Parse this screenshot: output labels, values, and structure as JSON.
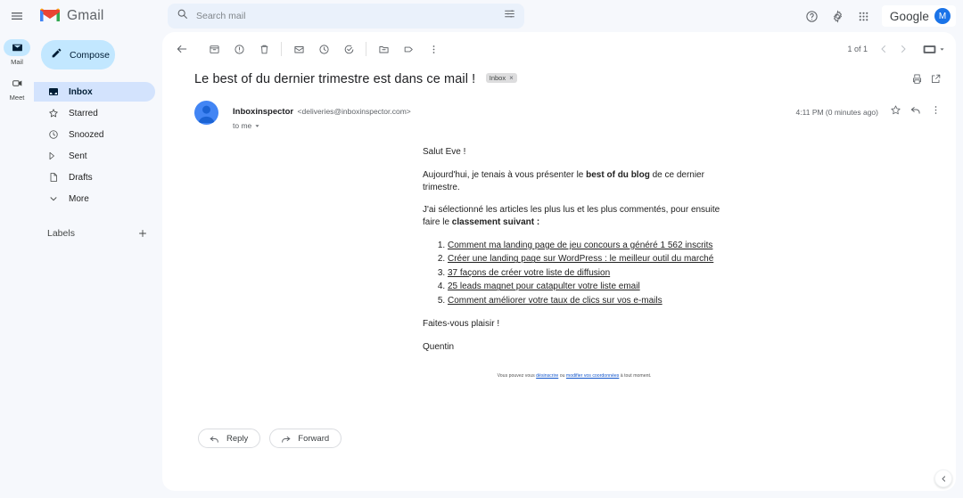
{
  "app": {
    "name": "Gmail"
  },
  "topbar": {
    "menu_icon": "hamburger-icon",
    "logo_icon": "gmail-logo-icon",
    "brand": "Gmail",
    "search": {
      "placeholder": "Search mail",
      "value": ""
    },
    "filter_icon": "search-options-icon",
    "help_icon": "help-icon",
    "settings_icon": "gear-icon",
    "apps_icon": "apps-grid-icon",
    "account": {
      "label": "Google",
      "initial": "M"
    }
  },
  "rail": {
    "items": [
      {
        "label": "Mail",
        "icon": "mail-icon",
        "active": true
      },
      {
        "label": "Meet",
        "icon": "meet-camera-icon",
        "active": false
      }
    ]
  },
  "sidebar": {
    "compose": {
      "label": "Compose",
      "icon": "pencil-icon"
    },
    "items": [
      {
        "label": "Inbox",
        "icon": "inbox-icon",
        "active": true
      },
      {
        "label": "Starred",
        "icon": "star-icon",
        "active": false
      },
      {
        "label": "Snoozed",
        "icon": "clock-icon",
        "active": false
      },
      {
        "label": "Sent",
        "icon": "send-icon",
        "active": false
      },
      {
        "label": "Drafts",
        "icon": "draft-icon",
        "active": false
      },
      {
        "label": "More",
        "icon": "chevron-down-icon",
        "active": false
      }
    ],
    "labels": {
      "title": "Labels",
      "add_icon": "plus-icon"
    }
  },
  "toolbar": {
    "back_icon": "back-arrow-icon",
    "archive_icon": "archive-icon",
    "spam_icon": "report-spam-icon",
    "delete_icon": "trash-icon",
    "unread_icon": "mark-unread-icon",
    "snooze_icon": "snooze-clock-icon",
    "tasks_icon": "add-to-tasks-icon",
    "move_icon": "move-to-folder-icon",
    "label_icon": "label-tag-icon",
    "more_icon": "more-vert-icon",
    "pager_text": "1 of 1",
    "prev_icon": "chevron-left-icon",
    "next_icon": "chevron-right-icon",
    "keyboard_icon": "input-tools-icon",
    "keyboard_caret_icon": "caret-down-icon"
  },
  "thread": {
    "subject": "Le best of du dernier trimestre est dans ce mail !",
    "label_chip": "Inbox",
    "label_chip_remove": "×",
    "print_icon": "print-icon",
    "popout_icon": "open-in-new-icon",
    "sender_name": "Inboxinspector",
    "sender_email": "<deliveries@inboxinspector.com>",
    "to_line": "to me",
    "to_caret_icon": "caret-down-icon",
    "time": "4:11 PM (0 minutes ago)",
    "star_icon": "star-outline-icon",
    "reply_icon": "reply-arrow-icon",
    "more_icon": "more-vert-icon"
  },
  "message": {
    "greeting": "Salut Eve !",
    "para1_before": "Aujourd'hui, je tenais à vous présenter le ",
    "para1_bold": "best of du blog",
    "para1_after": " de ce dernier trimestre.",
    "para2_before": "J'ai sélectionné les articles les plus lus et les plus commentés, pour ensuite faire le ",
    "para2_bold": "classement suivant :",
    "para2_after": "",
    "list": [
      "Comment ma landing page de jeu concours a généré 1 562 inscrits",
      "Créer une landing page sur WordPress : le meilleur outil du marché",
      "37 façons de créer votre liste de diffusion",
      "25 leads magnet pour catapulter votre liste email",
      "Comment améliorer votre taux de clics sur vos e-mails"
    ],
    "closing": "Faites-vous plaisir !",
    "signature": "Quentin",
    "footer_before": "Vous pouvez vous ",
    "footer_link1": "désinscrire",
    "footer_mid": " ou ",
    "footer_link2": "modifier vos coordonnées",
    "footer_after": " à tout moment."
  },
  "actions": {
    "reply": {
      "label": "Reply",
      "icon": "reply-arrow-icon"
    },
    "forward": {
      "label": "Forward",
      "icon": "forward-arrow-icon"
    },
    "collapse_icon": "chevron-left-icon"
  },
  "colors": {
    "accent": "#1a73e8",
    "compose_bg": "#c2e7ff",
    "active_nav_bg": "#d3e3fd",
    "app_bg": "#f6f8fc",
    "link": "#1155cc"
  }
}
